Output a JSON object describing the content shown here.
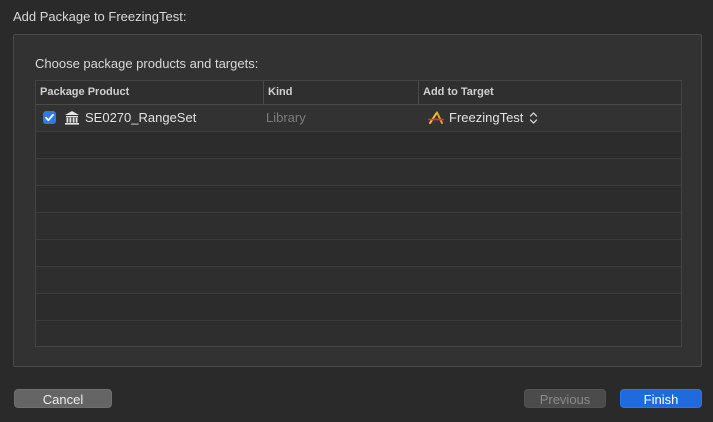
{
  "dialog": {
    "title": "Add Package to FreezingTest:",
    "prompt": "Choose package products and targets:"
  },
  "table": {
    "columns": [
      "Package Product",
      "Kind",
      "Add to Target"
    ],
    "rows": [
      {
        "checked": true,
        "product": "SE0270_RangeSet",
        "kind": "Library",
        "target": "FreezingTest"
      }
    ],
    "empty_rows": 8
  },
  "buttons": {
    "cancel": "Cancel",
    "previous": "Previous",
    "finish": "Finish"
  },
  "icons": {
    "checkbox": "checkmark-icon",
    "package": "library-columns-icon",
    "target": "app-target-icon",
    "stepper": "up-down-chevron-icon"
  },
  "colors": {
    "accent": "#1f6bde",
    "checkbox": "#2f7ae5"
  }
}
